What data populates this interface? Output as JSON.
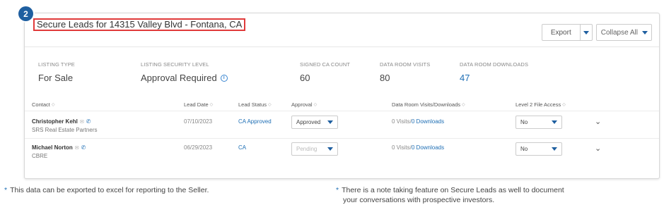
{
  "step_badge": "2",
  "title": "Secure Leads for 14315 Valley Blvd - Fontana, CA",
  "toolbar": {
    "export_label": "Export",
    "collapse_label": "Collapse All"
  },
  "metrics": [
    {
      "label": "LISTING TYPE",
      "value": "For Sale"
    },
    {
      "label": "LISTING SECURITY LEVEL",
      "value": "Approval Required"
    },
    {
      "label": "SIGNED CA COUNT",
      "value": "60"
    },
    {
      "label": "DATA ROOM VISITS",
      "value": "80"
    },
    {
      "label": "DATA ROOM DOWNLOADS",
      "value": "47"
    }
  ],
  "columns": [
    "Contact",
    "Lead Date",
    "Lead Status",
    "Approval",
    "Data Room Visits/Downloads",
    "Level 2 File Access"
  ],
  "rows": [
    {
      "name": "Christopher Kehl",
      "company": "SRS Real Estate Partners",
      "lead_date": "07/10/2023",
      "lead_status": "CA Approved",
      "approval": "Approved",
      "visits": "0 Visits",
      "downloads": "0 Downloads",
      "file_access": "No"
    },
    {
      "name": "Michael Norton",
      "company": "CBRE",
      "lead_date": "06/29/2023",
      "lead_status": "CA",
      "approval": "Pending",
      "visits": "0 Visits",
      "downloads": "0 Downloads",
      "file_access": "No"
    }
  ],
  "notes": {
    "left": "This data can be exported to excel for reporting to the Seller.",
    "right_line1": "There is a note taking feature on Secure Leads as well to document",
    "right_line2": "your conversations with prospective investors."
  }
}
